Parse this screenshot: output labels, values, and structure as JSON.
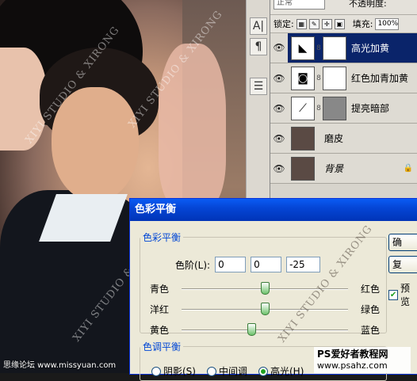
{
  "photo": {
    "watermarks": [
      "XIYI STUDIO & XIRONG",
      "XIYI STUDIO & XIRONG",
      "XIYI STUDIO & XIRONG",
      "XIYI STUDIO & XIRONG"
    ]
  },
  "toolbar_side": [
    "A|",
    "¶",
    "☰"
  ],
  "layers_panel": {
    "blend_mode": "正常",
    "opacity_label": "不透明度:",
    "lock_label": "锁定:",
    "fill_label": "填充:",
    "fill_value": "100%",
    "layers": [
      {
        "name": "高光加黄",
        "selected": true,
        "thumb_icon": "levels-icon",
        "has_mask": true
      },
      {
        "name": "红色加青加黄",
        "selected": false,
        "thumb_icon": "curves-icon",
        "has_mask": true
      },
      {
        "name": "提亮暗部",
        "selected": false,
        "thumb_icon": "curves-icon",
        "has_mask": true
      },
      {
        "name": "磨皮",
        "selected": false,
        "thumb_icon": "photo-icon",
        "has_mask": false
      },
      {
        "name": "背景",
        "selected": false,
        "thumb_icon": "photo-icon",
        "has_mask": false,
        "locked": true
      }
    ]
  },
  "dialog": {
    "title": "色彩平衡",
    "balance_group": "色彩平衡",
    "levels_label": "色阶(L):",
    "levels": [
      "0",
      "0",
      "-25"
    ],
    "sliders": [
      {
        "left": "青色",
        "right": "红色",
        "value": 0
      },
      {
        "left": "洋红",
        "right": "绿色",
        "value": 0
      },
      {
        "left": "黄色",
        "right": "蓝色",
        "value": -25
      }
    ],
    "ok_label": "确",
    "reset_label": "复",
    "preview_label": "预览",
    "preview_checked": true,
    "tone_group": "色调平衡",
    "tones": [
      {
        "label": "阴影(S)",
        "checked": false
      },
      {
        "label": "中间调",
        "checked": false
      },
      {
        "label": "高光(H)",
        "checked": true
      }
    ]
  },
  "credits": {
    "left": "思缘论坛 www.missyuan.com",
    "right_line1": "PS爱好者教程网",
    "right_line2": "www.psahz.com"
  }
}
